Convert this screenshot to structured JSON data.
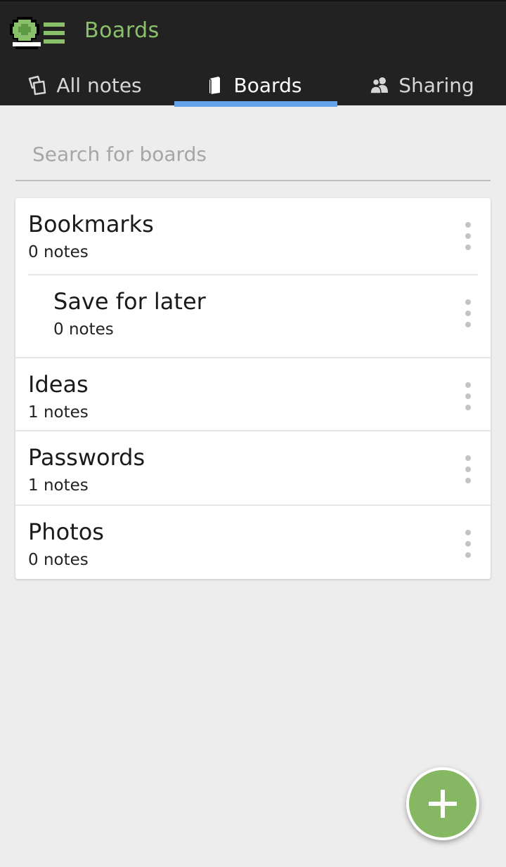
{
  "app": {
    "title": "Boards",
    "logo_icon": "turtle-shell-icon",
    "accent_color": "#8bc06a",
    "tab_indicator_color": "#66a3e8"
  },
  "tabs": [
    {
      "label": "All notes",
      "icon": "notes-icon",
      "active": false
    },
    {
      "label": "Boards",
      "icon": "board-icon",
      "active": true
    },
    {
      "label": "Sharing",
      "icon": "people-icon",
      "active": false
    }
  ],
  "search": {
    "placeholder": "Search for boards",
    "value": ""
  },
  "boards": [
    {
      "name": "Bookmarks",
      "count": "0 notes",
      "indent": false
    },
    {
      "name": "Save for later",
      "count": "0 notes",
      "indent": true
    },
    {
      "name": "Ideas",
      "count": "1 notes",
      "indent": false
    },
    {
      "name": "Passwords",
      "count": "1 notes",
      "indent": false
    },
    {
      "name": "Photos",
      "count": "0 notes",
      "indent": false
    }
  ],
  "fab": {
    "icon": "plus-icon",
    "color": "#86b762"
  }
}
